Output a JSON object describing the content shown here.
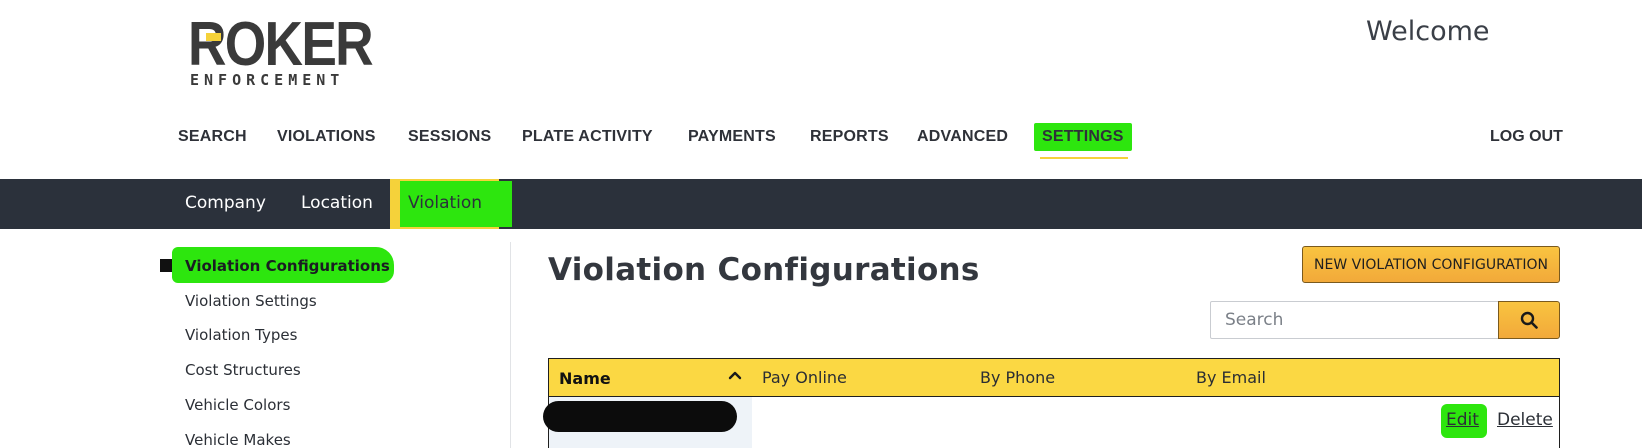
{
  "brand": {
    "logo_main": "ROKER",
    "logo_sub": "ENFORCEMENT",
    "accent_color": "#f5d23a",
    "highlight_color": "#2de60e"
  },
  "header": {
    "welcome": "Welcome",
    "logout": "LOG OUT"
  },
  "main_nav": {
    "items": [
      "SEARCH",
      "VIOLATIONS",
      "SESSIONS",
      "PLATE ACTIVITY",
      "PAYMENTS",
      "REPORTS",
      "ADVANCED",
      "SETTINGS"
    ],
    "active": "SETTINGS"
  },
  "sub_nav": {
    "items": [
      "Company",
      "Location",
      "Violation"
    ],
    "active": "Violation"
  },
  "sidebar": {
    "items": [
      "Violation Configurations",
      "Violation Settings",
      "Violation Types",
      "Cost Structures",
      "Vehicle Colors",
      "Vehicle Makes"
    ],
    "active": "Violation Configurations"
  },
  "main": {
    "title": "Violation Configurations",
    "new_button": "NEW VIOLATION CONFIGURATION",
    "search_placeholder": "Search",
    "search_icon": "search-icon",
    "table": {
      "columns": [
        "Name",
        "Pay Online",
        "By Phone",
        "By Email"
      ],
      "sort_icon": "chevron-up-icon",
      "rows": [
        {
          "name": "",
          "actions": [
            "Edit",
            "Delete"
          ]
        }
      ]
    }
  }
}
